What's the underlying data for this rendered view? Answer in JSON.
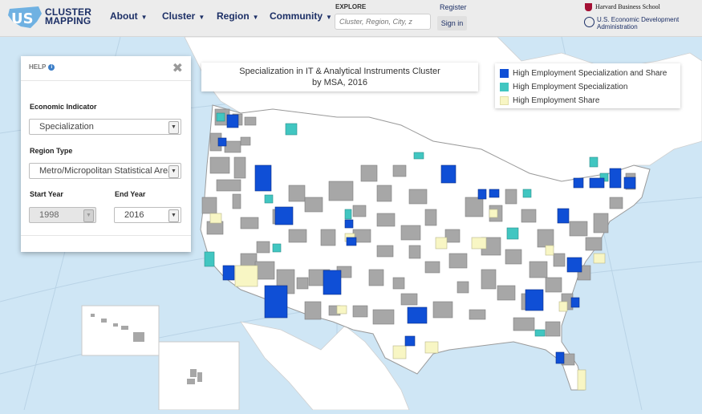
{
  "nav": {
    "logo_line1": "CLUSTER",
    "logo_line2": "MAPPING",
    "logo_mark": "US",
    "menu": [
      {
        "label": "About"
      },
      {
        "label": "Cluster"
      },
      {
        "label": "Region"
      },
      {
        "label": "Community"
      }
    ],
    "explore_label": "EXPLORE",
    "search_placeholder": "Cluster, Region, City, z",
    "register": "Register",
    "signin": "Sign in",
    "hbs": "Harvard Business School",
    "eda_line1": "U.S. Economic Development",
    "eda_line2": "Administration"
  },
  "map": {
    "title_line1": "Specialization in IT & Analytical Instruments Cluster",
    "title_line2": "by MSA, 2016",
    "legend": [
      {
        "label": "High Employment Specialization and Share",
        "color": "#0f4fd6"
      },
      {
        "label": "High Employment Specialization",
        "color": "#41c6c1"
      },
      {
        "label": "High Employment Share",
        "color": "#f8f6c4"
      }
    ],
    "colors": {
      "water": "#cfe6f5",
      "land": "#ffffff",
      "region_gray": "#a7a7a7",
      "border": "#8a8a8a"
    }
  },
  "help": {
    "title": "HELP",
    "indicator_label": "Economic Indicator",
    "indicator_value": "Specialization",
    "region_label": "Region Type",
    "region_value": "Metro/Micropolitan Statistical Area",
    "start_label": "Start Year",
    "start_value": "1998",
    "end_label": "End Year",
    "end_value": "2016"
  }
}
